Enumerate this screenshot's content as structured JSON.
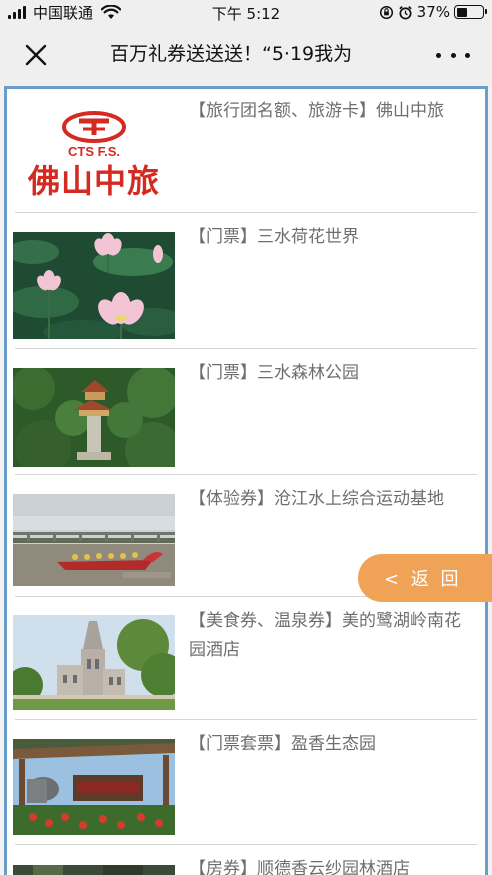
{
  "status_bar": {
    "carrier": "中国联通",
    "time": "下午 5:12",
    "battery_percent_text": "37%",
    "battery_level": 0.37,
    "icons": [
      "signal-icon",
      "wifi-icon",
      "rotation-lock-icon",
      "alarm-icon",
      "battery-icon"
    ]
  },
  "nav": {
    "title": "百万礼券送送送！“5·19我为",
    "close_icon": "close-icon",
    "more_icon": "more-icon"
  },
  "items": [
    {
      "label": "【旅行团名额、旅游卡】佛山中旅",
      "logo_text": "中旅",
      "logo_sub": "CTS F.S.",
      "logo_name": "佛山中旅",
      "logo_mark": "CTS"
    },
    {
      "label": "【门票】三水荷花世界"
    },
    {
      "label": "【门票】三水森林公园"
    },
    {
      "label": "【体验券】沧江水上综合运动基地"
    },
    {
      "label": "【美食券、温泉券】美的鹭湖岭南花园酒店"
    },
    {
      "label": "【门票套票】盈香生态园"
    },
    {
      "label": "【房券】顺德香云纱园林酒店"
    }
  ],
  "back_button": {
    "label": "< 返 回"
  },
  "colors": {
    "accent_orange": "#f0a257",
    "logo_red": "#d42a22",
    "frame_blue": "#6a9dc8",
    "text_gray": "#6e6e6e"
  }
}
